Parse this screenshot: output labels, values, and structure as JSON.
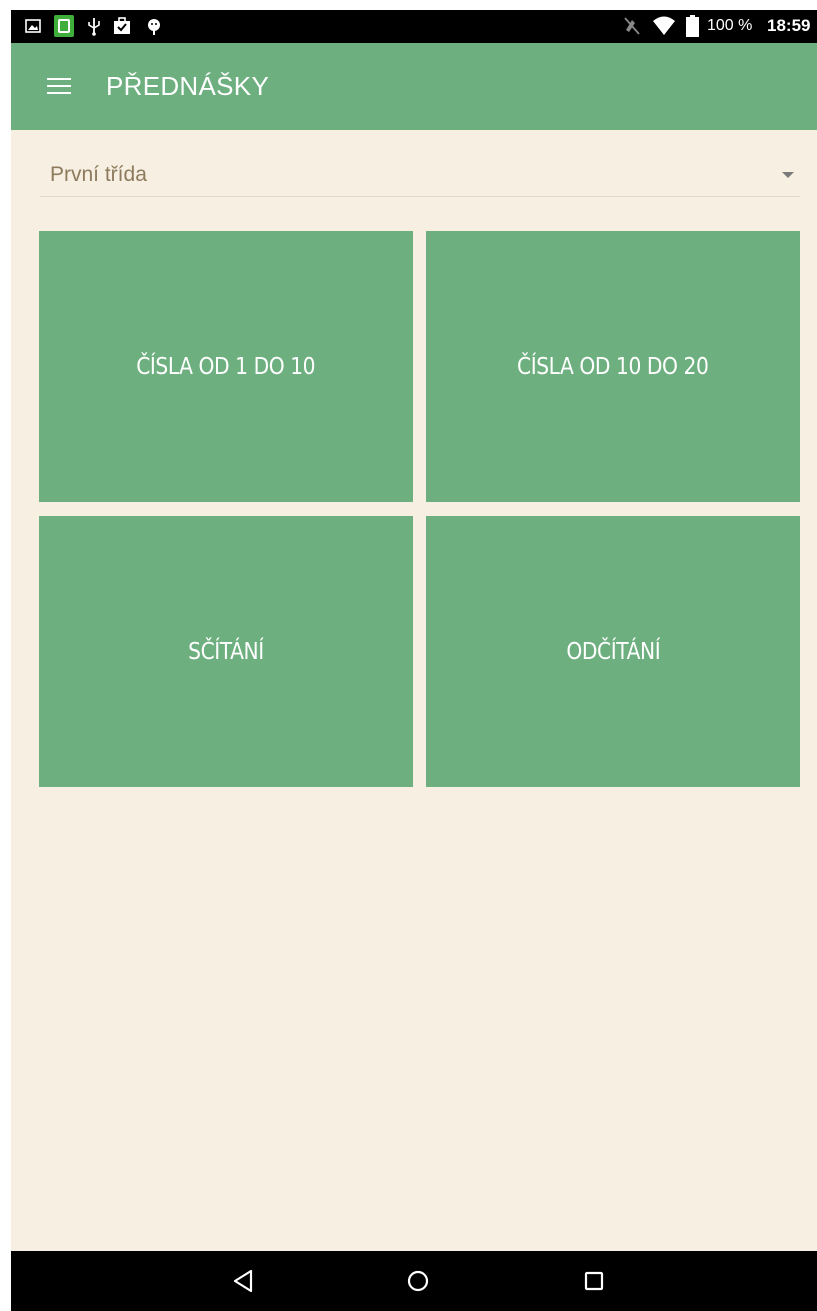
{
  "status_bar": {
    "battery_text": "100 %",
    "clock": "18:59",
    "left_icons": [
      "gallery-icon",
      "app-notification-icon",
      "usb-icon",
      "briefcase-icon",
      "android-debug-icon"
    ],
    "right_icons": [
      "mute-icon",
      "wifi-icon",
      "battery-icon"
    ]
  },
  "toolbar": {
    "title": "PŘEDNÁŠKY",
    "menu_icon": "hamburger-menu-icon"
  },
  "class_selector": {
    "selected": "První třída",
    "icon": "dropdown-arrow-icon"
  },
  "tiles": [
    {
      "label": "ČÍSLA OD 1 DO 10"
    },
    {
      "label": "ČÍSLA OD 10 DO 20"
    },
    {
      "label": "SČÍTÁNÍ"
    },
    {
      "label": "ODČÍTÁNÍ"
    }
  ],
  "nav_bar": {
    "buttons": [
      "back-icon",
      "home-icon",
      "recents-icon"
    ]
  },
  "colors": {
    "accent": "#6daf7f",
    "background": "#f6efe2",
    "spinner_text": "#8c7b5c"
  }
}
